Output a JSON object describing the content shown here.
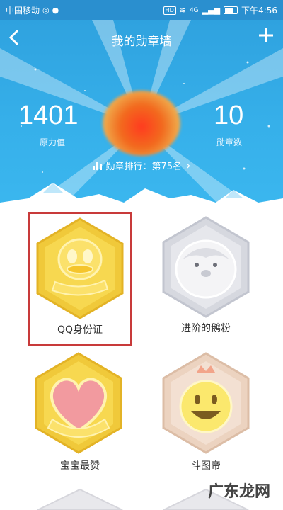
{
  "status_bar": {
    "carrier": "中国移动",
    "time": "下午4:56",
    "hd": "HD",
    "network": "4G"
  },
  "header": {
    "back_icon": "chevron-left-icon",
    "title": "我的勋章墙",
    "add_icon": "plus-icon"
  },
  "stats": {
    "power_value": "1401",
    "power_label": "原力值",
    "badge_count": "10",
    "badge_count_label": "勋章数",
    "rank_text": "勋章排行：第75名",
    "rank_chevron": "›"
  },
  "badges": [
    {
      "label": "QQ身份证",
      "icon": "qq-penguin-gold-icon",
      "selected": true
    },
    {
      "label": "进阶的鹅粉",
      "icon": "penguin-silver-icon",
      "selected": false
    },
    {
      "label": "宝宝最赞",
      "icon": "heart-gold-icon",
      "selected": false
    },
    {
      "label": "斗图帝",
      "icon": "smiley-crown-icon",
      "selected": false
    }
  ],
  "watermark": "广东龙网",
  "colors": {
    "hero_blue": "#36b0ea",
    "gold": "#f3cf3a",
    "silver": "#d9dbe3",
    "selection_red": "#c83a3a"
  }
}
